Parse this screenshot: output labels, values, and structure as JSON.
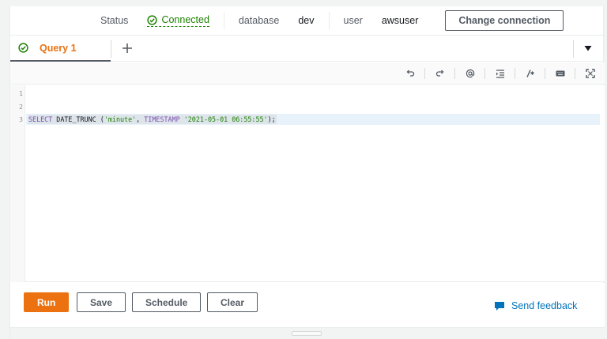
{
  "status": {
    "status_label": "Status",
    "status_value": "Connected",
    "database_label": "database",
    "database_value": "dev",
    "user_label": "user",
    "user_value": "awsuser",
    "change_connection_label": "Change connection"
  },
  "tabs": [
    {
      "label": "Query 1",
      "icon": "check-circle-icon",
      "active": true
    }
  ],
  "tab_bar": {
    "add_icon": "plus-icon",
    "menu_icon": "caret-down-icon"
  },
  "editor_toolbar": [
    {
      "name": "undo-icon"
    },
    {
      "name": "redo-icon"
    },
    {
      "name": "at-sign-icon"
    },
    {
      "name": "format-indent-icon"
    },
    {
      "name": "comment-icon"
    },
    {
      "name": "keyboard-icon"
    },
    {
      "name": "fullscreen-icon"
    }
  ],
  "editor": {
    "line_numbers": [
      "1",
      "2",
      "3"
    ],
    "active_line": 3,
    "code": {
      "kw1": "SELECT",
      "fn": " DATE_TRUNC (",
      "str1": "'minute'",
      "mid": ", ",
      "kw2": "TIMESTAMP",
      "sp": " ",
      "str2": "'2021-05-01 06:55:55'",
      "end": ");"
    }
  },
  "actions": {
    "run_label": "Run",
    "save_label": "Save",
    "schedule_label": "Schedule",
    "clear_label": "Clear",
    "feedback_label": "Send feedback"
  },
  "colors": {
    "accent_orange": "#ec7211",
    "success_green": "#1d8102",
    "link_blue": "#0073bb",
    "keyword_purple": "#7d4eb1"
  }
}
